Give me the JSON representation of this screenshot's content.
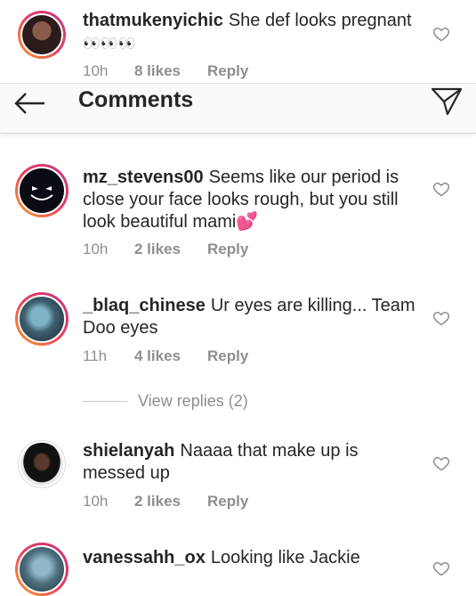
{
  "header": {
    "title": "Comments",
    "back_icon": "arrow-left-icon",
    "send_icon": "paper-plane-icon"
  },
  "comments": [
    {
      "username": "thatmukenyichic",
      "text": "She def looks pregnant",
      "emoji": "👀👀👀",
      "time": "10h",
      "likes": "8 likes",
      "reply": "Reply"
    },
    {
      "username": "mz_stevens00",
      "text": "Seems like our period is close your face looks rough, but you still look beautiful mami",
      "emoji": "💕",
      "time": "10h",
      "likes": "2 likes",
      "reply": "Reply"
    },
    {
      "username": "_blaq_chinese",
      "text": "Ur eyes are killing... Team Doo eyes",
      "time": "11h",
      "likes": "4 likes",
      "reply": "Reply"
    },
    {
      "username": "shielanyah",
      "text": "Naaaa that make up is messed up",
      "time": "10h",
      "likes": "2 likes",
      "reply": "Reply"
    },
    {
      "username": "vanessahh_ox",
      "text": "Looking like Jackie"
    }
  ],
  "view_replies": "View replies (2)",
  "colors": {
    "text": "#262626",
    "muted": "#8e8e8e",
    "ring_start": "#f9a32c",
    "ring_end": "#c13584"
  }
}
